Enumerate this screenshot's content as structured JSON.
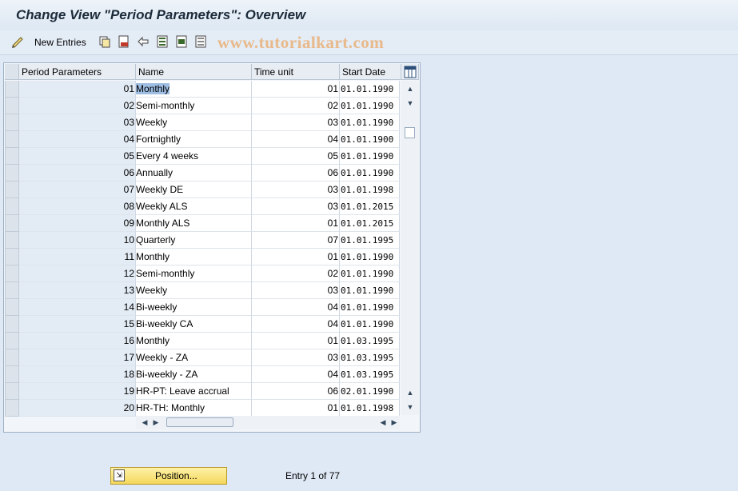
{
  "window": {
    "title": "Change View \"Period Parameters\": Overview"
  },
  "toolbar": {
    "new_entries_label": "New Entries",
    "icons": [
      "edit-glasses-icon",
      "copy-icon",
      "delete-icon",
      "undo-icon",
      "select-all-icon",
      "select-block-icon",
      "deselect-all-icon"
    ]
  },
  "watermark": "www.tutorialkart.com",
  "table": {
    "columns": [
      "Period Parameters",
      "Name",
      "Time unit",
      "Start Date"
    ],
    "rows": [
      {
        "param": "01",
        "name": "Monthly",
        "time_unit": "01",
        "start_date": "01.01.1990"
      },
      {
        "param": "02",
        "name": "Semi-monthly",
        "time_unit": "02",
        "start_date": "01.01.1990"
      },
      {
        "param": "03",
        "name": "Weekly",
        "time_unit": "03",
        "start_date": "01.01.1990"
      },
      {
        "param": "04",
        "name": "Fortnightly",
        "time_unit": "04",
        "start_date": "01.01.1900"
      },
      {
        "param": "05",
        "name": "Every 4 weeks",
        "time_unit": "05",
        "start_date": "01.01.1990"
      },
      {
        "param": "06",
        "name": "Annually",
        "time_unit": "06",
        "start_date": "01.01.1990"
      },
      {
        "param": "07",
        "name": "Weekly  DE",
        "time_unit": "03",
        "start_date": "01.01.1998"
      },
      {
        "param": "08",
        "name": "Weekly ALS",
        "time_unit": "03",
        "start_date": "01.01.2015"
      },
      {
        "param": "09",
        "name": "Monthly ALS",
        "time_unit": "01",
        "start_date": "01.01.2015"
      },
      {
        "param": "10",
        "name": "Quarterly",
        "time_unit": "07",
        "start_date": "01.01.1995"
      },
      {
        "param": "11",
        "name": "Monthly",
        "time_unit": "01",
        "start_date": "01.01.1990"
      },
      {
        "param": "12",
        "name": "Semi-monthly",
        "time_unit": "02",
        "start_date": "01.01.1990"
      },
      {
        "param": "13",
        "name": "Weekly",
        "time_unit": "03",
        "start_date": "01.01.1990"
      },
      {
        "param": "14",
        "name": "Bi-weekly",
        "time_unit": "04",
        "start_date": "01.01.1990"
      },
      {
        "param": "15",
        "name": "Bi-weekly CA",
        "time_unit": "04",
        "start_date": "01.01.1990"
      },
      {
        "param": "16",
        "name": "Monthly",
        "time_unit": "01",
        "start_date": "01.03.1995"
      },
      {
        "param": "17",
        "name": "Weekly - ZA",
        "time_unit": "03",
        "start_date": "01.03.1995"
      },
      {
        "param": "18",
        "name": "Bi-weekly - ZA",
        "time_unit": "04",
        "start_date": "01.03.1995"
      },
      {
        "param": "19",
        "name": "HR-PT: Leave accrual",
        "time_unit": "06",
        "start_date": "02.01.1990"
      },
      {
        "param": "20",
        "name": "HR-TH: Monthly",
        "time_unit": "01",
        "start_date": "01.01.1998"
      }
    ]
  },
  "footer": {
    "position_button_label": "Position...",
    "entry_info": "Entry 1 of 77"
  }
}
